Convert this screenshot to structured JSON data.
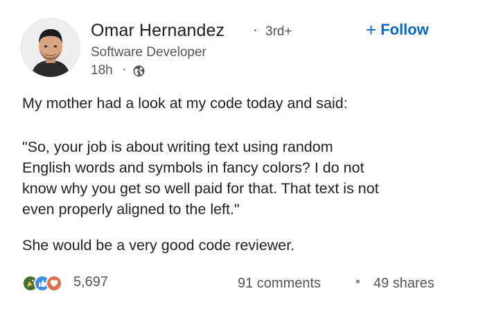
{
  "author": {
    "name": "Omar Hernandez",
    "connection_separator": "·",
    "connection_degree": "3rd+",
    "headline": "Software Developer",
    "time_ago": "18h",
    "time_separator": "·",
    "visibility_icon": "globe-icon"
  },
  "follow_button": {
    "icon": "+",
    "label": "Follow",
    "color": "#0a66c2"
  },
  "post": {
    "paragraph_1": "My mother had a look at my code today and said:",
    "paragraph_2": "\"So, your job is about writing text using random\nEnglish words and symbols in fancy colors? I do not\nknow why you get so well paid for that. That text is not\neven properly aligned to the left.\"",
    "paragraph_3": "She would be a very good code reviewer."
  },
  "social": {
    "reaction_icons": [
      "celebrate-icon",
      "like-icon",
      "love-icon"
    ],
    "reaction_count": "5,697",
    "comments": "91 comments",
    "separator": "•",
    "shares": "49 shares"
  }
}
